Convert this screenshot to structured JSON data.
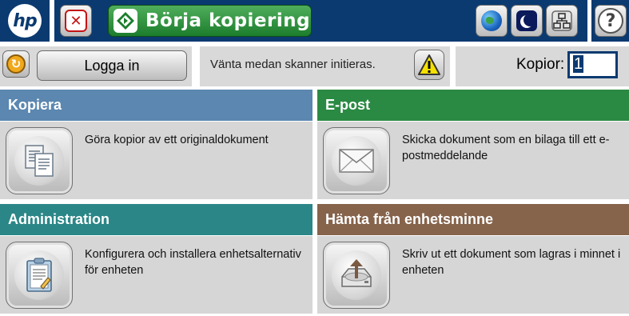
{
  "header": {
    "logo_text": "hp",
    "start_label": "Börja kopiering"
  },
  "statusbar": {
    "login_label": "Logga in",
    "message": "Vänta medan skanner initieras.",
    "copies_label": "Kopior:",
    "copies_value": "1"
  },
  "tiles": [
    {
      "title": "Kopiera",
      "description": "Göra kopior av ett originaldokument",
      "icon": "copy-documents-icon",
      "color": "#5b87b0"
    },
    {
      "title": "E-post",
      "description": "Skicka dokument som en bilaga till ett e-postmeddelande",
      "icon": "envelope-icon",
      "color": "#2a8a43"
    },
    {
      "title": "Administration",
      "description": "Konfigurera och installera enhetsalternativ för enheten",
      "icon": "clipboard-icon",
      "color": "#2b8687"
    },
    {
      "title": "Hämta från enhetsminne",
      "description": "Skriv ut ett dokument som lagras i minnet i enheten",
      "icon": "device-memory-icon",
      "color": "#86634b"
    }
  ],
  "colors": {
    "header_background": "#0a3a70",
    "start_button": "#1c7d2c",
    "stop_button": "#c41414"
  }
}
